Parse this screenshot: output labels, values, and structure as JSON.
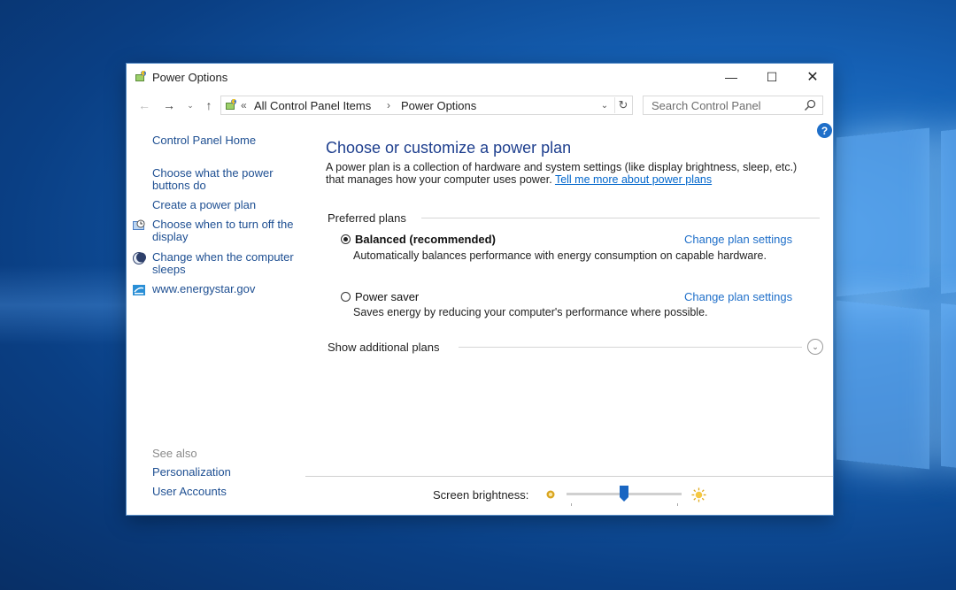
{
  "window": {
    "title": "Power Options",
    "controls": {
      "minimize": "—",
      "maximize": "☐",
      "close": "✕"
    }
  },
  "navbar": {
    "back_glyph": "←",
    "forward_glyph": "→",
    "recent_glyph": "⌄",
    "up_glyph": "↑",
    "address": {
      "prefix": "«",
      "crumbs": [
        "All Control Panel Items",
        "Power Options"
      ],
      "separator": "›",
      "dropdown_glyph": "⌄",
      "refresh_glyph": "↻"
    },
    "search": {
      "placeholder": "Search Control Panel",
      "value": ""
    }
  },
  "help_glyph": "?",
  "sidebar": {
    "home": "Control Panel Home",
    "links": [
      {
        "label": "Choose what the power buttons do",
        "icon": ""
      },
      {
        "label": "Create a power plan",
        "icon": ""
      },
      {
        "label": "Choose when to turn off the display",
        "icon": "display-clock-icon"
      },
      {
        "label": "Change when the computer sleeps",
        "icon": "moon-icon"
      },
      {
        "label": "www.energystar.gov",
        "icon": "energystar-icon"
      }
    ],
    "see_also": {
      "heading": "See also",
      "links": [
        "Personalization",
        "User Accounts"
      ]
    }
  },
  "main": {
    "heading": "Choose or customize a power plan",
    "description": "A power plan is a collection of hardware and system settings (like display brightness, sleep, etc.) that manages how your computer uses power.",
    "learn_more": "Tell me more about power plans",
    "preferred_heading": "Preferred plans",
    "plans": [
      {
        "name": "Balanced (recommended)",
        "selected": true,
        "description": "Automatically balances performance with energy consumption on capable hardware.",
        "settings_link": "Change plan settings"
      },
      {
        "name": "Power saver",
        "selected": false,
        "description": "Saves energy by reducing your computer's performance where possible.",
        "settings_link": "Change plan settings"
      }
    ],
    "additional_plans": "Show additional plans",
    "expand_glyph": "⌄"
  },
  "brightness": {
    "label": "Screen brightness:",
    "level_fraction": 0.5
  },
  "colors": {
    "link": "#1f6fc9",
    "heading": "#1e3f8e",
    "desktop": "#1560b4"
  }
}
